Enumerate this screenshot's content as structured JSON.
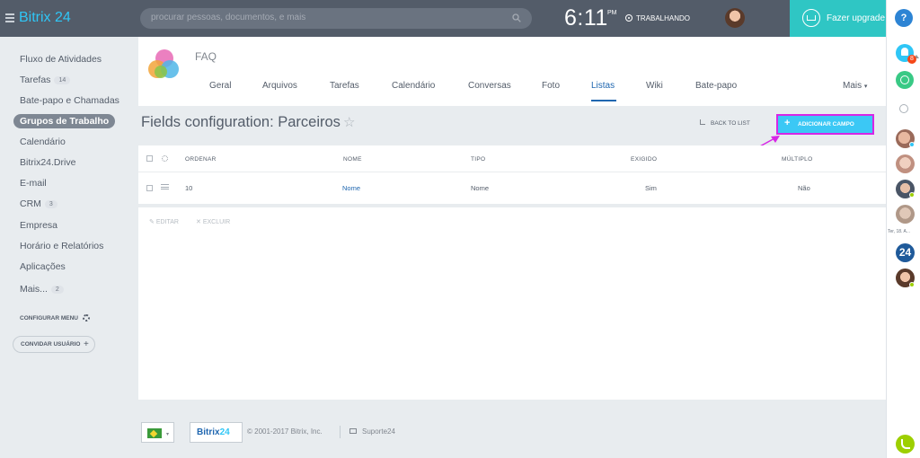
{
  "header": {
    "logo": {
      "brand": "Bitrix",
      "version": "24"
    },
    "search_placeholder": "procurar pessoas, documentos, e mais",
    "clock": {
      "time": "6:11",
      "period": "PM"
    },
    "work_status": "TRABALHANDO",
    "upgrade_label": "Fazer upgrade",
    "help_label": "?"
  },
  "sidebar": {
    "items": [
      {
        "label": "Fluxo de Atividades"
      },
      {
        "label": "Tarefas",
        "count": "14"
      },
      {
        "label": "Bate-papo e Chamadas"
      },
      {
        "label": "Grupos de Trabalho",
        "active": true
      },
      {
        "label": "Calendário"
      },
      {
        "label": "Bitrix24.Drive"
      },
      {
        "label": "E-mail"
      },
      {
        "label": "CRM",
        "count": "3"
      },
      {
        "label": "Empresa"
      },
      {
        "label": "Horário e Relatórios"
      },
      {
        "label": "Aplicações"
      },
      {
        "label": "Mais...",
        "count": "2"
      }
    ],
    "configure_label": "CONFIGURAR MENU",
    "invite_label": "CONVIDAR USUÁRIO"
  },
  "group": {
    "name": "FAQ",
    "tabs": [
      "Geral",
      "Arquivos",
      "Tarefas",
      "Calendário",
      "Conversas",
      "Foto",
      "Listas",
      "Wiki",
      "Bate-papo",
      "Mais"
    ],
    "active_tab": "Listas"
  },
  "page": {
    "title": "Fields configuration: Parceiros",
    "back_label": "BACK TO LIST",
    "add_label": "ADICIONAR CAMPO"
  },
  "grid": {
    "columns": [
      "ORDENAR",
      "NOME",
      "TIPO",
      "EXIGIDO",
      "MÚLTIPLO"
    ],
    "rows": [
      {
        "order": "10",
        "name": "Nome",
        "type": "Nome",
        "required": "Sim",
        "multiple": "Não"
      }
    ],
    "actions": {
      "edit": "EDITAR",
      "delete": "EXCLUIR"
    }
  },
  "rail": {
    "notification_count": "8",
    "date_label": "Ter, 18. A...",
    "bitrix_avatar_label": "24"
  },
  "footer": {
    "logo": {
      "brand": "Bitrix",
      "version": "24"
    },
    "copyright": "© 2001-2017 Bitrix, Inc.",
    "support_label": "Suporte24"
  },
  "colors": {
    "accent": "#2fc6f6",
    "link": "#2067b0",
    "highlight": "#d726e6",
    "upgrade": "#2fc6c4"
  }
}
